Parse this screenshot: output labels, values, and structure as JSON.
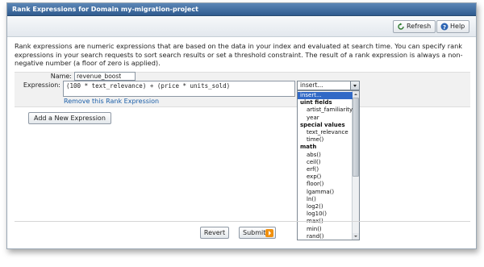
{
  "window": {
    "title": "Rank Expressions for Domain my-migration-project"
  },
  "toolbar": {
    "refresh_label": "Refresh",
    "help_label": "Help"
  },
  "description": "Rank expressions are numeric expressions that are based on the data in your index and evaluated at search time. You can specify rank expressions in your search requests to sort search results or set a threshold constraint. The result of a rank expression is always a non-negative number (a floor of zero is applied).",
  "form": {
    "name_label": "Name:",
    "name_value": "revenue_boost",
    "expression_label": "Expression:",
    "expression_value": "(100 * text_relevance) + (price * units_sold)",
    "remove_link": "Remove this Rank Expression",
    "add_button": "Add a New Expression"
  },
  "insert_select": {
    "selected": "insert...",
    "options": [
      {
        "label": "insert...",
        "kind": "selected"
      },
      {
        "label": "uint fields",
        "kind": "group"
      },
      {
        "label": "artist_familiarity",
        "kind": "option"
      },
      {
        "label": "year",
        "kind": "option"
      },
      {
        "label": "special values",
        "kind": "group"
      },
      {
        "label": "text_relevance",
        "kind": "option"
      },
      {
        "label": "time()",
        "kind": "option"
      },
      {
        "label": "math",
        "kind": "group"
      },
      {
        "label": "abs()",
        "kind": "option"
      },
      {
        "label": "ceil()",
        "kind": "option"
      },
      {
        "label": "erf()",
        "kind": "option"
      },
      {
        "label": "exp()",
        "kind": "option"
      },
      {
        "label": "floor()",
        "kind": "option"
      },
      {
        "label": "lgamma()",
        "kind": "option"
      },
      {
        "label": "ln()",
        "kind": "option"
      },
      {
        "label": "log2()",
        "kind": "option"
      },
      {
        "label": "log10()",
        "kind": "option"
      },
      {
        "label": "max()",
        "kind": "option"
      },
      {
        "label": "min()",
        "kind": "option"
      },
      {
        "label": "rand()",
        "kind": "option"
      }
    ]
  },
  "footer": {
    "revert_label": "Revert",
    "submit_label": "Submit"
  },
  "colors": {
    "titlebar": "#3c6aa0",
    "link": "#1a5ea8",
    "selection": "#3169c6",
    "submit_icon": "#f0900f"
  },
  "icons": [
    "refresh-icon",
    "help-icon",
    "submit-arrow-icon",
    "dropdown-arrow-icon"
  ]
}
